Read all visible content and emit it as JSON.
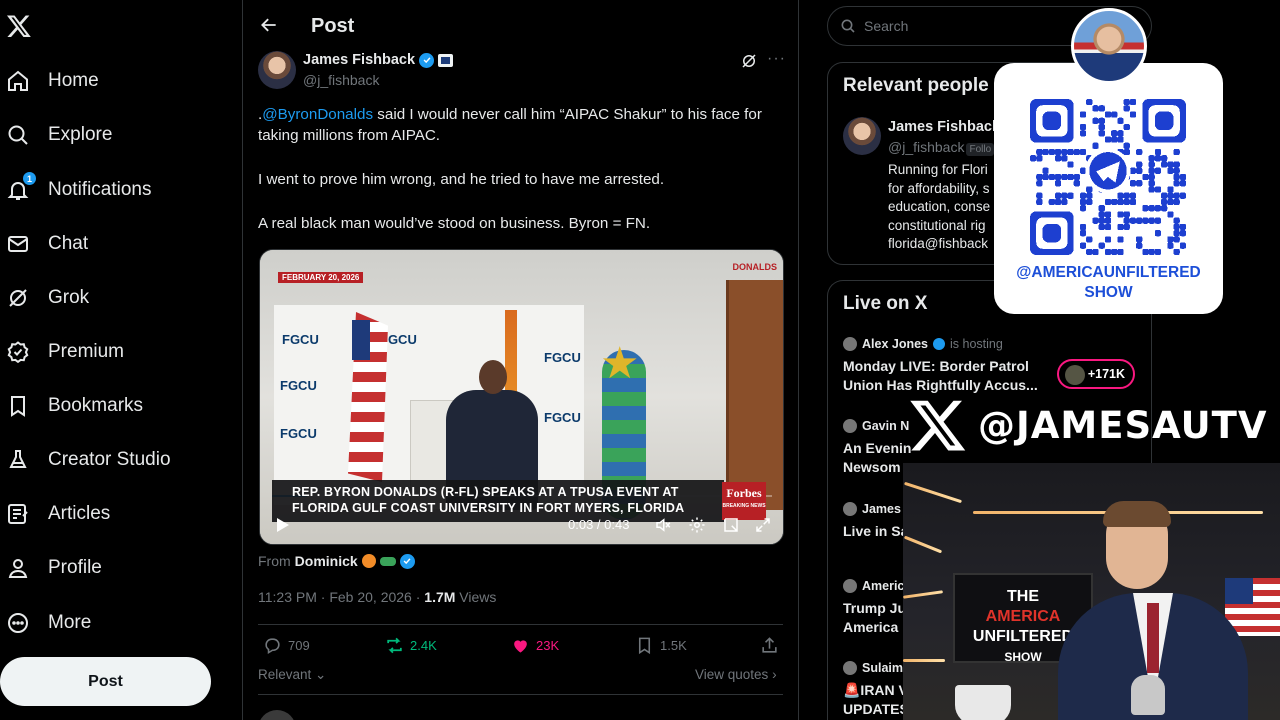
{
  "nav": {
    "items": [
      {
        "label": "Home",
        "icon": "home-icon"
      },
      {
        "label": "Explore",
        "icon": "search-icon"
      },
      {
        "label": "Notifications",
        "icon": "bell-icon",
        "badge": "1"
      },
      {
        "label": "Chat",
        "icon": "mail-icon"
      },
      {
        "label": "Grok",
        "icon": "grok-icon"
      },
      {
        "label": "Premium",
        "icon": "premium-icon"
      },
      {
        "label": "Bookmarks",
        "icon": "bookmark-icon"
      },
      {
        "label": "Creator Studio",
        "icon": "flask-icon"
      },
      {
        "label": "Articles",
        "icon": "article-icon"
      },
      {
        "label": "Profile",
        "icon": "person-icon"
      },
      {
        "label": "More",
        "icon": "more-circle-icon"
      }
    ],
    "post_button": "Post"
  },
  "header": {
    "title": "Post"
  },
  "tweet": {
    "author_name": "James Fishback",
    "author_handle": "@j_fishback",
    "text_mention": "@ByronDonalds",
    "text_p1_prefix": ".",
    "text_p1_rest": " said I would never call him “AIPAC Shakur” to his face for taking millions from AIPAC.",
    "text_p2": "I went to prove him wrong, and he tried to have me arrested.",
    "text_p3": "A real black man would’ve stood on business. Byron = FN.",
    "video": {
      "date_tag": "FEBRUARY 20, 2026",
      "brand_tag": "DONALDS",
      "chyron": "REP. BYRON DONALDS (R-FL) SPEAKS AT A TPUSA EVENT AT FLORIDA GULF COAST UNIVERSITY IN FORT MYERS, FLORIDA",
      "network": "Forbes",
      "network_sub": "BREAKING NEWS",
      "time": "0:03 / 0:43",
      "progress": 0.07,
      "backdrop_text": "FGCU"
    },
    "from_label": "From",
    "from_name": "Dominick",
    "timestamp": "11:23 PM · Feb 20, 2026 · ",
    "views_count": "1.7M",
    "views_label": " Views",
    "stats": {
      "replies": "709",
      "reposts": "2.4K",
      "likes": "23K",
      "bookmarks": "1.5K"
    },
    "sort_label": "Relevant",
    "view_quotes": "View quotes"
  },
  "colors": {
    "accent": "#1d9bf0",
    "repost": "#00ba7c",
    "like": "#f91880",
    "border": "#2f3336",
    "muted": "#71767b"
  },
  "search": {
    "placeholder": "Search"
  },
  "relevant_people": {
    "title": "Relevant people",
    "name": "James Fishback",
    "handle": "@j_fishback",
    "follows_tag": "Follo",
    "bio_lines": [
      "Running for Flori",
      "for affordability, s",
      "education, conse",
      "constitutional rig",
      "florida@fishback"
    ]
  },
  "live": {
    "title": "Live on X",
    "items": [
      {
        "host": "Alex Jones",
        "hosting": "is hosting",
        "title_1": "Monday LIVE: Border Patrol",
        "title_2": "Union Has Rightfully Accus..."
      },
      {
        "host": "Gavin N",
        "title_1": "An Evenin",
        "title_2": "Newsom"
      },
      {
        "host": "James I",
        "title_1": "Live in Sa",
        "title_2": ""
      },
      {
        "host": "Americ",
        "title_1": "Trump Ju",
        "title_2": "America |"
      },
      {
        "host": "Sulaim",
        "title_1": "🚨IRAN V",
        "title_2": "UPDATES"
      }
    ],
    "listeners": "+171K"
  },
  "overlay": {
    "qr_caption_1": "@AMERICAUNFILTERED",
    "qr_caption_2": "SHOW",
    "handle": "@JAMESAUTV",
    "show_1": "THE",
    "show_2": "AMERICA",
    "show_3": "UNFILTERED",
    "show_4": "SHOW"
  }
}
